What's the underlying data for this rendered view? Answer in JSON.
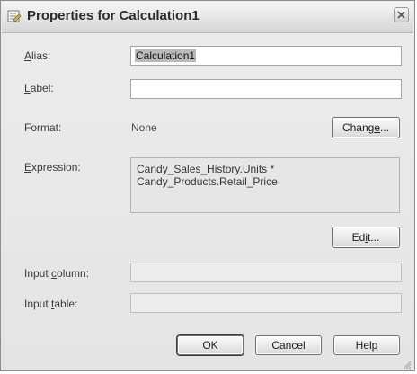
{
  "window": {
    "title": "Properties for Calculation1"
  },
  "form": {
    "alias": {
      "label": "Alias:",
      "value": "Calculation1"
    },
    "label_field": {
      "label": "Label:",
      "value": ""
    },
    "format": {
      "label": "Format:",
      "value": "None",
      "button": "Change..."
    },
    "expression": {
      "label": "Expression:",
      "lines": [
        "Candy_Sales_History.Units *",
        "Candy_Products.Retail_Price"
      ],
      "button": "Edit..."
    },
    "input_column": {
      "label": "Input column:",
      "value": ""
    },
    "input_table": {
      "label": "Input table:",
      "value": ""
    }
  },
  "buttons": {
    "ok": "OK",
    "cancel": "Cancel",
    "help": "Help"
  },
  "icons": {
    "app": "calculation-properties-icon",
    "close": "close-icon",
    "resize": "resize-grip-icon"
  }
}
